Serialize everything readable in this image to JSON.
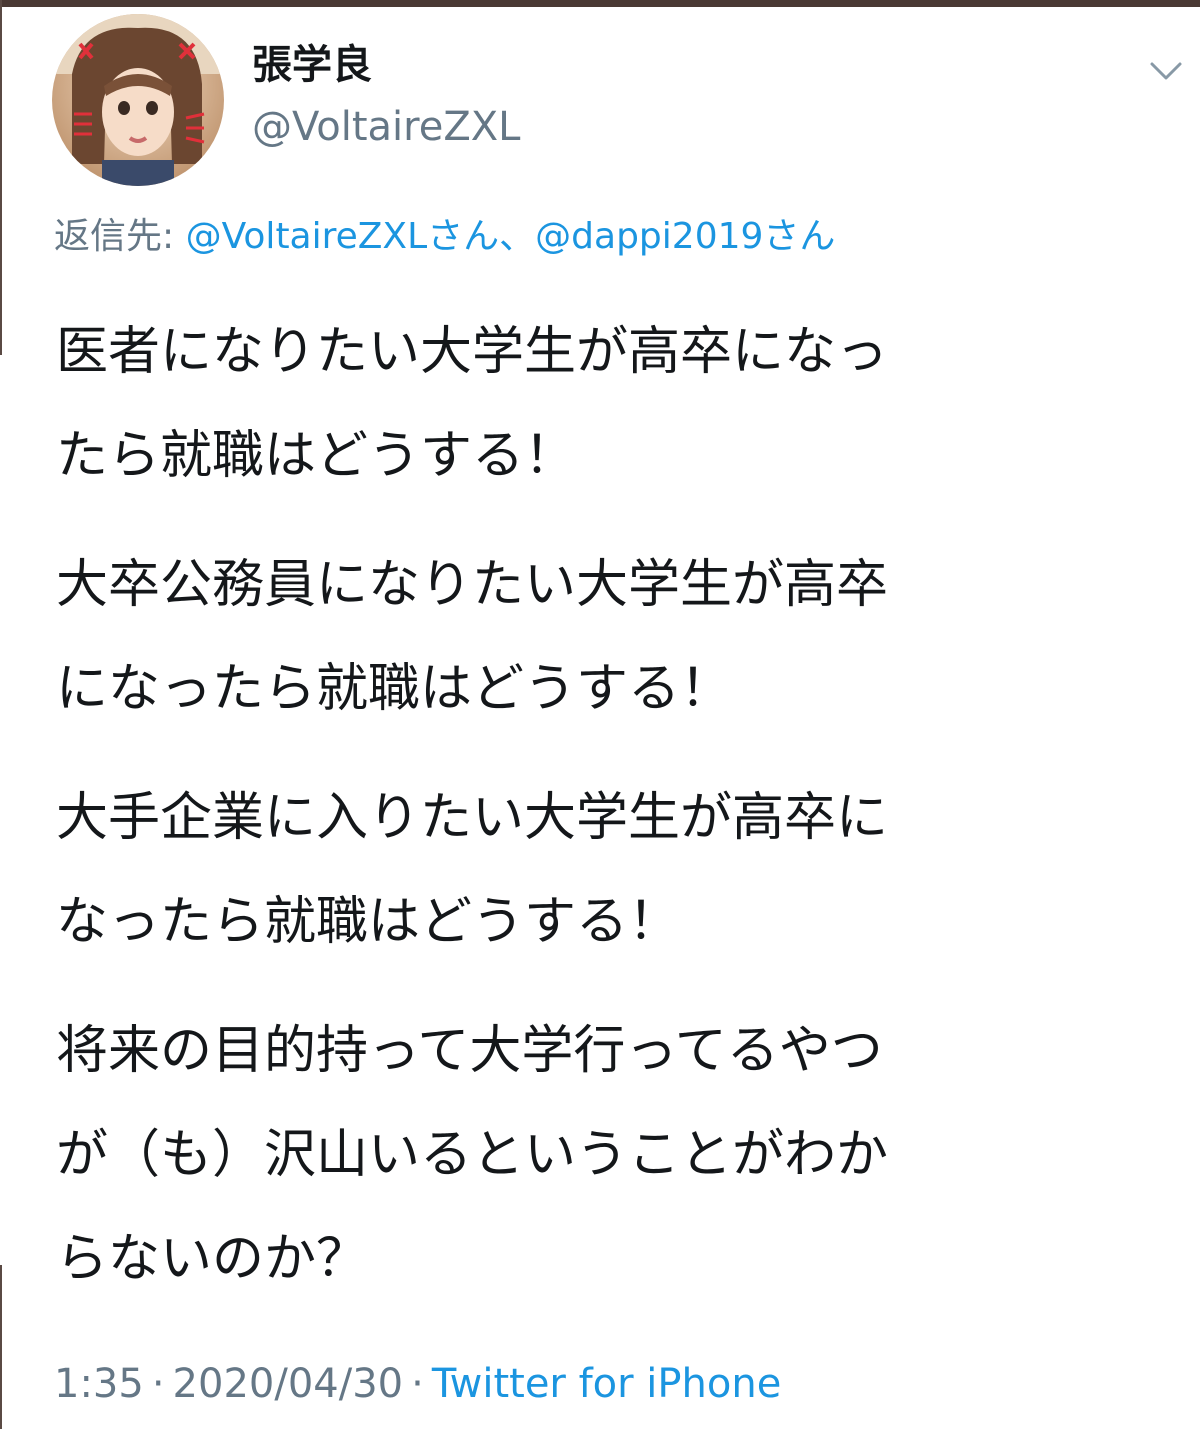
{
  "tweet": {
    "author": {
      "display_name": "張学良",
      "handle": "@VoltaireZXL",
      "avatar_icon": "profile-photo-avatar"
    },
    "menu_icon": "chevron-down-icon",
    "reply": {
      "prefix": "返信先: ",
      "mentions": [
        "@VoltaireZXLさん",
        "@dappi2019さん"
      ],
      "separator": "、"
    },
    "paragraphs": [
      "医者になりたい大学生が高卒になっ\nたら就職はどうする！",
      "大卒公務員になりたい大学生が高卒\nになったら就職はどうする！",
      "大手企業に入りたい大学生が高卒に\nなったら就職はどうする！",
      "将来の目的持って大学行ってるやつ\nが（も）沢山いるということがわか\nらないのか？"
    ],
    "time": "1:35",
    "date": "2020/04/30",
    "separator": "·",
    "source": "Twitter for iPhone"
  },
  "colors": {
    "text": "#14171a",
    "secondary": "#657786",
    "link": "#1b95e0",
    "top_bar": "#4a3934"
  }
}
